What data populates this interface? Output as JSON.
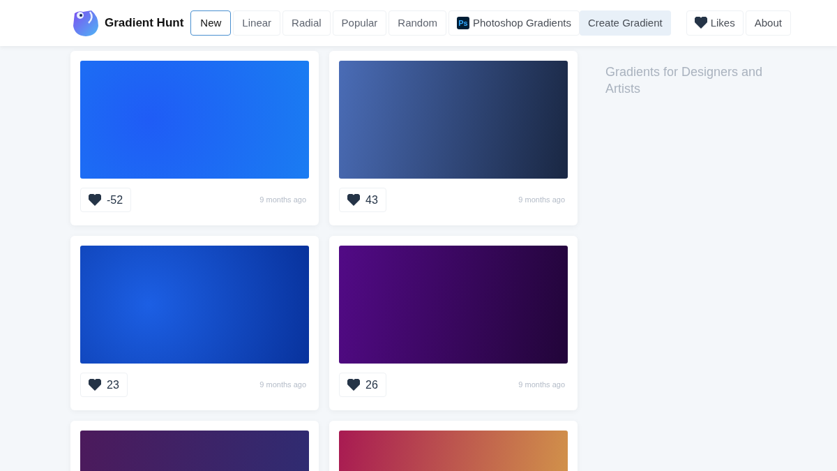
{
  "brand": {
    "name": "Gradient Hunt"
  },
  "nav": [
    {
      "label": "New",
      "selected": true
    },
    {
      "label": "Linear",
      "selected": false
    },
    {
      "label": "Radial",
      "selected": false
    },
    {
      "label": "Popular",
      "selected": false
    },
    {
      "label": "Random",
      "selected": false
    }
  ],
  "photoshop_link": {
    "badge": "Ps",
    "label": "Photoshop Gradients"
  },
  "create_button": "Create Gradient",
  "likes_button": "Likes",
  "about_button": "About",
  "cards": [
    {
      "kind": "radial",
      "stops": [
        {
          "color": "#1f5cf6"
        },
        {
          "color": "#1a7cf2"
        }
      ],
      "likes": "-52",
      "time": "9 months ago"
    },
    {
      "kind": "linear",
      "stops": [
        {
          "color": "#4a6cb6"
        },
        {
          "color": "#1b2946"
        }
      ],
      "likes": "43",
      "time": "9 months ago"
    },
    {
      "kind": "radial",
      "stops": [
        {
          "color": "#1c5fe4"
        },
        {
          "color": "#08329c"
        }
      ],
      "likes": "23",
      "time": "9 months ago"
    },
    {
      "kind": "linear",
      "stops": [
        {
          "color": "#520a86"
        },
        {
          "color": "#23053b"
        }
      ],
      "likes": "26",
      "time": "9 months ago"
    },
    {
      "kind": "linear",
      "stops": [
        {
          "color": "#4c1a5c"
        },
        {
          "color": "#2f2c72"
        }
      ]
    },
    {
      "kind": "linear",
      "stops": [
        {
          "color": "#a81a52"
        },
        {
          "color": "#d2944a"
        }
      ]
    }
  ],
  "sidebar": {
    "title": "Gradients for Designers and Artists"
  }
}
